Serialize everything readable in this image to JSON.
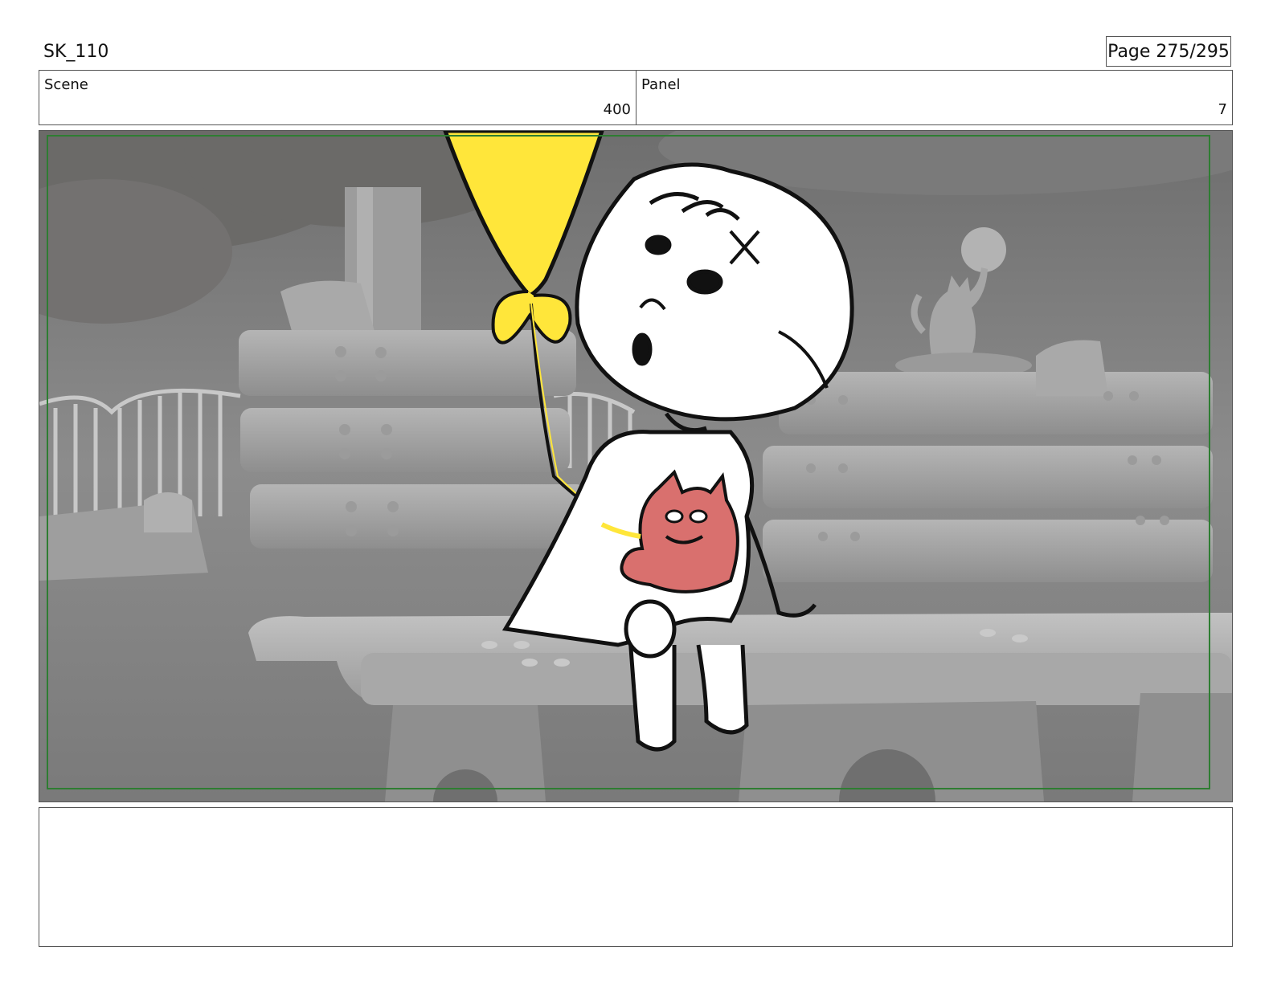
{
  "header": {
    "project_code": "SK_110",
    "page_label": "Page 275/295"
  },
  "info": {
    "scene_label": "Scene",
    "scene_value": "400",
    "panel_label": "Panel",
    "panel_value": "7"
  },
  "notes": {
    "text": ""
  },
  "colors": {
    "balloon": "#ffe63a",
    "plush": "#d9706e",
    "safe_frame": "#2e7d32",
    "background_gray": "#8a8a8a"
  }
}
